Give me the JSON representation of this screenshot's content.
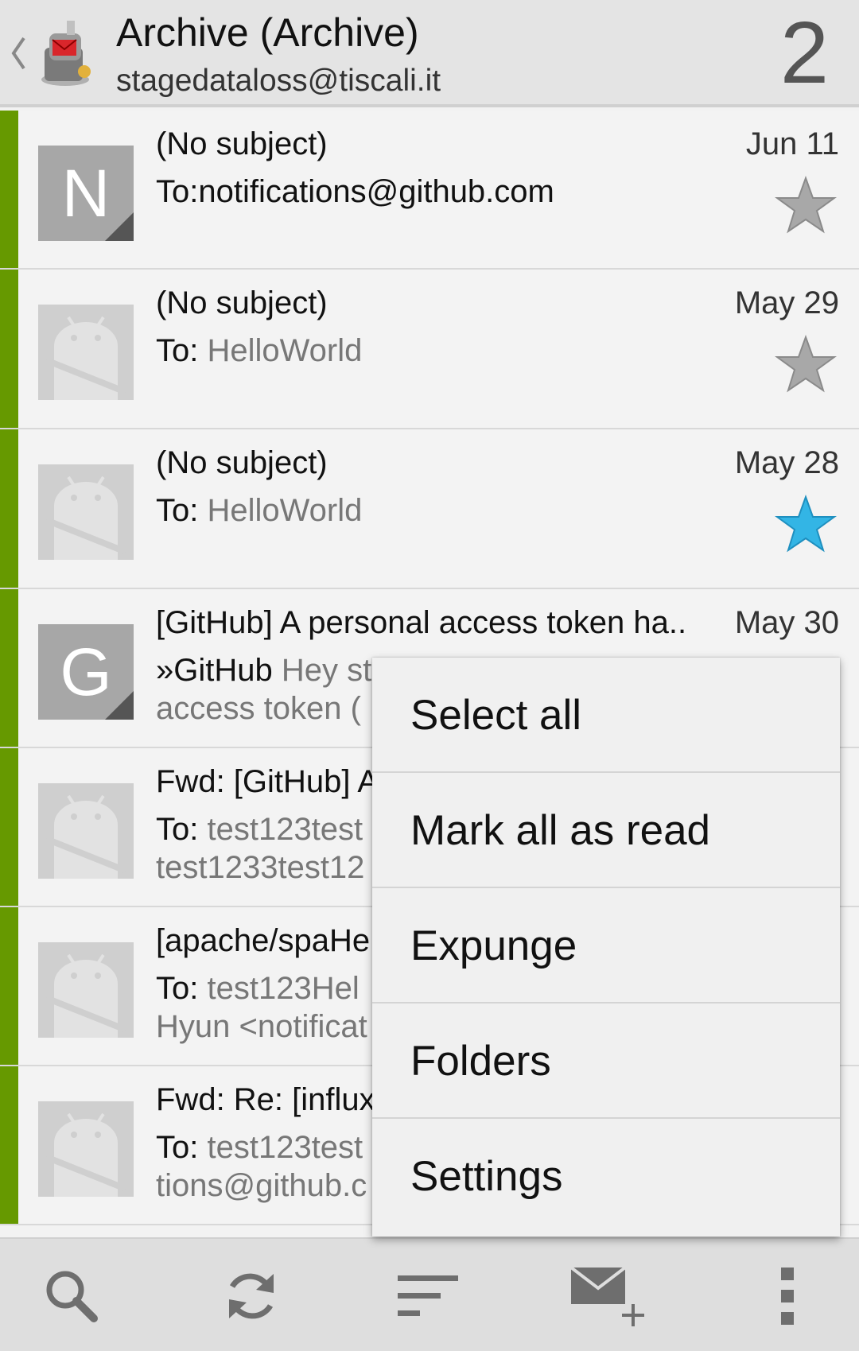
{
  "header": {
    "title": "Archive (Archive)",
    "account": "stagedataloss@tiscali.it",
    "unread_count": "2"
  },
  "messages": [
    {
      "avatar": "N",
      "subject": "(No subject)",
      "to_label": "To:",
      "to": "notifications@github.com",
      "date": "Jun 11",
      "starred": false
    },
    {
      "avatar": "android-icon",
      "subject": "(No subject)",
      "to_label": "To: ",
      "to": "HelloWorld",
      "date": "May 29",
      "starred": false
    },
    {
      "avatar": "android-icon",
      "subject": "(No subject)",
      "to_label": "To: ",
      "to": "HelloWorld",
      "date": "May 28",
      "starred": true
    },
    {
      "avatar": "G",
      "subject": "[GitHub] A personal access token ha..",
      "from": "»GitHub ",
      "preview": "Hey st",
      "preview2": "access token (",
      "date": "May 30"
    },
    {
      "avatar": "android-icon",
      "subject": "Fwd: [GitHub] A",
      "to_label": "To: ",
      "to": "test123test",
      "preview2": "test1233test12"
    },
    {
      "avatar": "android-icon",
      "subject": "[apache/spaHe",
      "to_label": "To: ",
      "to": "test123Hel",
      "preview2": "Hyun <notificat"
    },
    {
      "avatar": "android-icon",
      "subject": "Fwd: Re: [influx",
      "to_label": "To: ",
      "to": "test123test",
      "preview2": "tions@github.c"
    }
  ],
  "menu": {
    "items": [
      "Select all",
      "Mark all as read",
      "Expunge",
      "Folders",
      "Settings"
    ]
  },
  "bottom_bar": {
    "icons": [
      "search-icon",
      "refresh-icon",
      "sort-icon",
      "compose-icon",
      "overflow-menu-icon"
    ]
  },
  "colors": {
    "account_bar": "#669900",
    "star_active": "#33b5e5",
    "star_inactive": "#9e9e9e"
  }
}
